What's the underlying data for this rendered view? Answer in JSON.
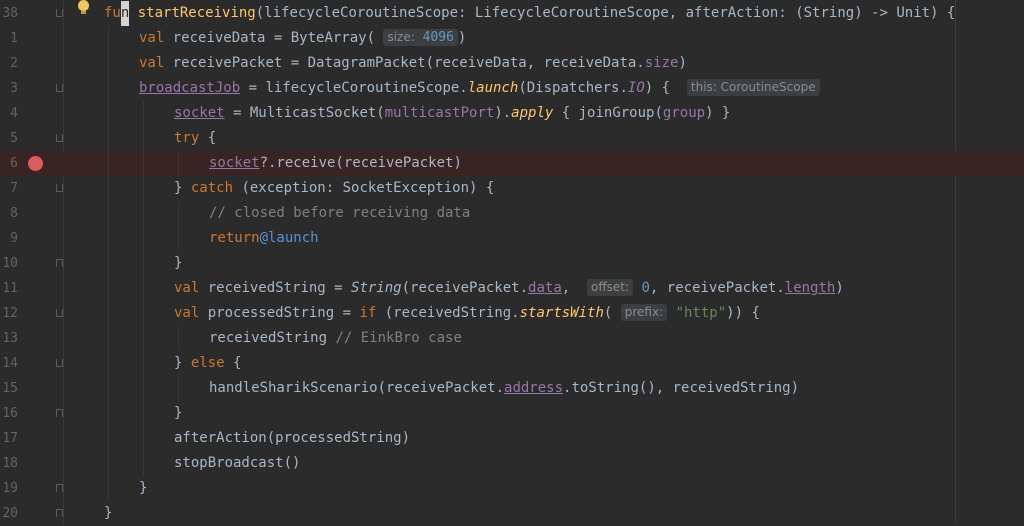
{
  "editor": {
    "lines": [
      {
        "n": "38",
        "fold": "open",
        "bulb": true,
        "tokens": [
          {
            "t": "fu",
            "c": "kw"
          },
          {
            "t": "n",
            "c": "cursor"
          },
          {
            "t": " "
          },
          {
            "t": "startReceiving",
            "c": "fn"
          },
          {
            "t": "(lifecycleCoroutineScope: LifecycleCoroutineScope, afterAction: (String) -> Unit) {"
          }
        ]
      },
      {
        "n": "1",
        "indent": 1,
        "tokens": [
          {
            "t": "val",
            "c": "kw"
          },
          {
            "t": " receiveData = ByteArray( "
          },
          {
            "t": "size:",
            "c": "hint",
            "v": "4096"
          },
          {
            "t": ")"
          }
        ]
      },
      {
        "n": "2",
        "indent": 1,
        "tokens": [
          {
            "t": "val",
            "c": "kw"
          },
          {
            "t": " receivePacket = DatagramPacket(receiveData, receiveData."
          },
          {
            "t": "size",
            "c": "prop"
          },
          {
            "t": ")"
          }
        ]
      },
      {
        "n": "3",
        "indent": 1,
        "fold": "open",
        "tokens": [
          {
            "t": "broadcastJob",
            "c": "prop-u"
          },
          {
            "t": " = lifecycleCoroutineScope."
          },
          {
            "t": "launch",
            "c": "ext"
          },
          {
            "t": "(Dispatchers."
          },
          {
            "t": "IO",
            "c": "prop ital"
          },
          {
            "t": ") {  "
          },
          {
            "t": "this: CoroutineScope",
            "c": "hint"
          }
        ]
      },
      {
        "n": "4",
        "indent": 2,
        "tokens": [
          {
            "t": "socket",
            "c": "prop-u"
          },
          {
            "t": " = MulticastSocket("
          },
          {
            "t": "multicastPort",
            "c": "prop"
          },
          {
            "t": ")."
          },
          {
            "t": "apply",
            "c": "ext"
          },
          {
            "t": " { joinGroup("
          },
          {
            "t": "group",
            "c": "prop"
          },
          {
            "t": ") }"
          }
        ]
      },
      {
        "n": "5",
        "indent": 2,
        "fold": "open",
        "tokens": [
          {
            "t": "try",
            "c": "kw"
          },
          {
            "t": " {"
          }
        ]
      },
      {
        "n": "6",
        "indent": 3,
        "breakpoint": true,
        "tokens": [
          {
            "t": "socket",
            "c": "prop-u"
          },
          {
            "t": "?.receive(receivePacket)"
          }
        ]
      },
      {
        "n": "7",
        "indent": 2,
        "fold": "open",
        "tokens": [
          {
            "t": "} "
          },
          {
            "t": "catch",
            "c": "kw"
          },
          {
            "t": " (exception: SocketException) {"
          }
        ]
      },
      {
        "n": "8",
        "indent": 3,
        "tokens": [
          {
            "t": "// closed before receiving data",
            "c": "cmt"
          }
        ]
      },
      {
        "n": "9",
        "indent": 3,
        "tokens": [
          {
            "t": "return",
            "c": "kw"
          },
          {
            "t": "@launch",
            "c": "lbl"
          }
        ]
      },
      {
        "n": "10",
        "indent": 2,
        "fold": "close",
        "tokens": [
          {
            "t": "}"
          }
        ]
      },
      {
        "n": "11",
        "indent": 2,
        "tokens": [
          {
            "t": "val",
            "c": "kw"
          },
          {
            "t": " receivedString = "
          },
          {
            "t": "String",
            "c": "ital"
          },
          {
            "t": "(receivePacket."
          },
          {
            "t": "data",
            "c": "prop-u"
          },
          {
            "t": ",  "
          },
          {
            "t": "offset:",
            "c": "hint"
          },
          {
            "t": " 0",
            "c": "num"
          },
          {
            "t": ", receivePacket."
          },
          {
            "t": "length",
            "c": "prop-u"
          },
          {
            "t": ")"
          }
        ]
      },
      {
        "n": "12",
        "indent": 2,
        "fold": "open",
        "tokens": [
          {
            "t": "val",
            "c": "kw"
          },
          {
            "t": " processedString = "
          },
          {
            "t": "if",
            "c": "kw"
          },
          {
            "t": " (receivedString."
          },
          {
            "t": "startsWith",
            "c": "ext"
          },
          {
            "t": "( "
          },
          {
            "t": "prefix:",
            "c": "hint"
          },
          {
            "t": " "
          },
          {
            "t": "\"http\"",
            "c": "str"
          },
          {
            "t": ")) {"
          }
        ]
      },
      {
        "n": "13",
        "indent": 3,
        "tokens": [
          {
            "t": "receivedString "
          },
          {
            "t": "// EinkBro case",
            "c": "cmt"
          }
        ]
      },
      {
        "n": "14",
        "indent": 2,
        "fold": "open",
        "tokens": [
          {
            "t": "} "
          },
          {
            "t": "else",
            "c": "kw"
          },
          {
            "t": " {"
          }
        ]
      },
      {
        "n": "15",
        "indent": 3,
        "tokens": [
          {
            "t": "handleSharikScenario(receivePacket."
          },
          {
            "t": "address",
            "c": "prop-u"
          },
          {
            "t": ".toString(), receivedString)"
          }
        ]
      },
      {
        "n": "16",
        "indent": 2,
        "fold": "close",
        "tokens": [
          {
            "t": "}"
          }
        ]
      },
      {
        "n": "17",
        "indent": 2,
        "tokens": [
          {
            "t": "afterAction(processedString)"
          }
        ]
      },
      {
        "n": "18",
        "indent": 2,
        "tokens": [
          {
            "t": "stopBroadcast()"
          }
        ]
      },
      {
        "n": "19",
        "indent": 1,
        "fold": "close",
        "tokens": [
          {
            "t": "}"
          }
        ]
      },
      {
        "n": "20",
        "indent": 0,
        "fold": "close",
        "tokens": [
          {
            "t": "}"
          }
        ]
      }
    ]
  },
  "colors": {
    "background": "#2b2b2b",
    "keyword": "#cc7832",
    "function": "#ffc66d",
    "number": "#6897bb",
    "string": "#6a8759",
    "property": "#9876aa",
    "comment": "#808080",
    "breakpoint": "#db5c5c"
  }
}
